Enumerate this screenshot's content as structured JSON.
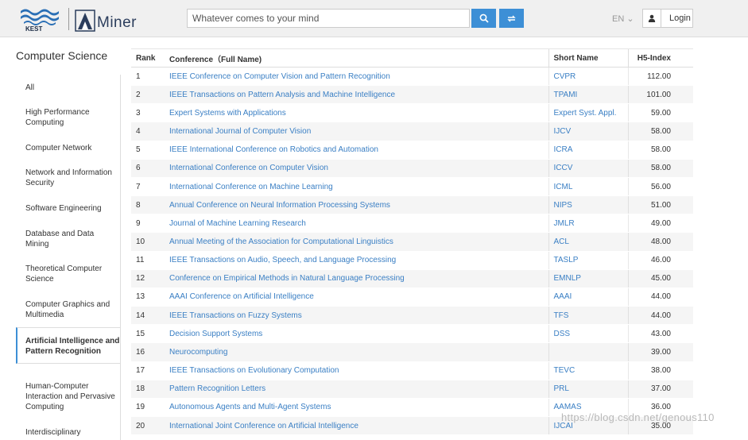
{
  "header": {
    "logo_kest_text": "KEST",
    "logo_aminer_text": "Miner",
    "search_placeholder": "Whatever comes to your mind",
    "language": "EN ⌄",
    "login_label": "Login",
    "accent_color": "#3d8fd6"
  },
  "sidebar": {
    "title": "Computer Science",
    "items": [
      {
        "label": "All"
      },
      {
        "label": "High Performance Computing"
      },
      {
        "label": "Computer Network"
      },
      {
        "label": "Network and Information Security"
      },
      {
        "label": "Software Engineering"
      },
      {
        "label": "Database and Data Mining"
      },
      {
        "label": "Theoretical Computer Science"
      },
      {
        "label": "Computer Graphics and Multimedia"
      },
      {
        "label": "Artificial Intelligence and Pattern Recognition",
        "active": true
      },
      {
        "label": "Human-Computer Interaction and Pervasive Computing"
      },
      {
        "label": "Interdisciplinary"
      }
    ]
  },
  "table": {
    "headers": {
      "rank": "Rank",
      "conference": "Conference（Full Name)",
      "short": "Short Name",
      "h5": "H5-Index"
    },
    "rows": [
      {
        "rank": "1",
        "name": "IEEE Conference on Computer Vision and Pattern Recognition",
        "short": "CVPR",
        "h5": "112.00"
      },
      {
        "rank": "2",
        "name": "IEEE Transactions on Pattern Analysis and Machine Intelligence",
        "short": "TPAMI",
        "h5": "101.00"
      },
      {
        "rank": "3",
        "name": "Expert Systems with Applications",
        "short": "Expert Syst. Appl.",
        "h5": "59.00"
      },
      {
        "rank": "4",
        "name": "International Journal of Computer Vision",
        "short": "IJCV",
        "h5": "58.00"
      },
      {
        "rank": "5",
        "name": "IEEE International Conference on Robotics and Automation",
        "short": "ICRA",
        "h5": "58.00"
      },
      {
        "rank": "6",
        "name": "International Conference on Computer Vision",
        "short": "ICCV",
        "h5": "58.00"
      },
      {
        "rank": "7",
        "name": "International Conference on Machine Learning",
        "short": "ICML",
        "h5": "56.00"
      },
      {
        "rank": "8",
        "name": "Annual Conference on Neural Information Processing Systems",
        "short": "NIPS",
        "h5": "51.00"
      },
      {
        "rank": "9",
        "name": "Journal of Machine Learning Research",
        "short": "JMLR",
        "h5": "49.00"
      },
      {
        "rank": "10",
        "name": "Annual Meeting of the Association for Computational Linguistics",
        "short": "ACL",
        "h5": "48.00"
      },
      {
        "rank": "11",
        "name": "IEEE Transactions on Audio, Speech, and Language Processing",
        "short": "TASLP",
        "h5": "46.00"
      },
      {
        "rank": "12",
        "name": "Conference on Empirical Methods in Natural Language Processing",
        "short": "EMNLP",
        "h5": "45.00"
      },
      {
        "rank": "13",
        "name": "AAAI Conference on Artificial Intelligence",
        "short": "AAAI",
        "h5": "44.00"
      },
      {
        "rank": "14",
        "name": "IEEE Transactions on Fuzzy Systems",
        "short": "TFS",
        "h5": "44.00"
      },
      {
        "rank": "15",
        "name": "Decision Support Systems",
        "short": "DSS",
        "h5": "43.00"
      },
      {
        "rank": "16",
        "name": "Neurocomputing",
        "short": "",
        "h5": "39.00"
      },
      {
        "rank": "17",
        "name": "IEEE Transactions on Evolutionary Computation",
        "short": "TEVC",
        "h5": "38.00"
      },
      {
        "rank": "18",
        "name": "Pattern Recognition Letters",
        "short": "PRL",
        "h5": "37.00"
      },
      {
        "rank": "19",
        "name": "Autonomous Agents and Multi-Agent Systems",
        "short": "AAMAS",
        "h5": "36.00"
      },
      {
        "rank": "20",
        "name": "International Joint Conference on Artificial Intelligence",
        "short": "IJCAI",
        "h5": "35.00"
      }
    ]
  },
  "watermark": "https://blog.csdn.net/genous110"
}
